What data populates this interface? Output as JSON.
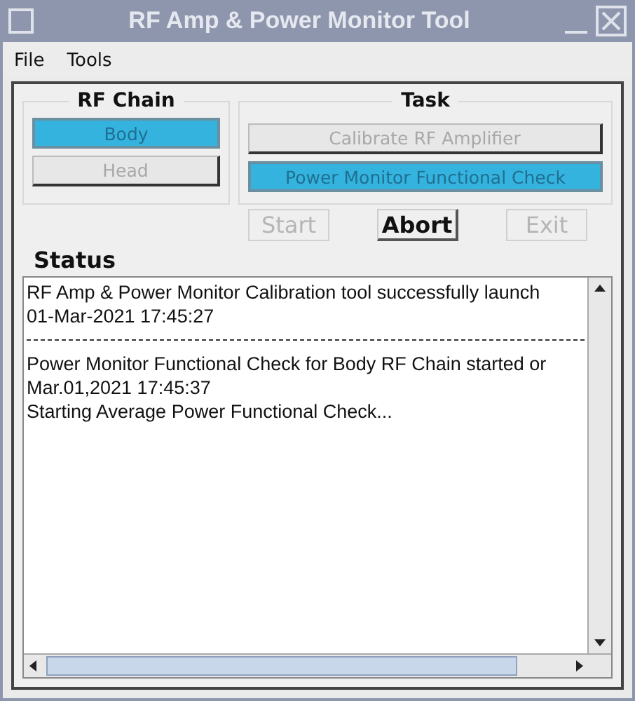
{
  "window": {
    "title": "RF Amp & Power Monitor Tool"
  },
  "menu": [
    "File",
    "Tools"
  ],
  "rf_chain": {
    "title": "RF Chain",
    "options": [
      {
        "label": "Body",
        "selected": true,
        "disabled": false
      },
      {
        "label": "Head",
        "selected": false,
        "disabled": true
      }
    ]
  },
  "task": {
    "title": "Task",
    "options": [
      {
        "label": "Calibrate RF Amplifier",
        "selected": false,
        "disabled": true
      },
      {
        "label": "Power Monitor Functional Check",
        "selected": true,
        "disabled": false
      }
    ]
  },
  "actions": [
    {
      "label": "Start",
      "disabled": true
    },
    {
      "label": "Abort",
      "disabled": false
    },
    {
      "label": "Exit",
      "disabled": true
    }
  ],
  "status": {
    "title": "Status",
    "entries": [
      {
        "lines": [
          "RF Amp & Power Monitor Calibration tool successfully launch",
          "01-Mar-2021 17:45:27"
        ]
      },
      {
        "lines": [
          "Power Monitor Functional Check for Body RF Chain started or",
          "Mar.01,2021 17:45:37",
          "Starting Average Power Functional Check..."
        ]
      }
    ]
  }
}
